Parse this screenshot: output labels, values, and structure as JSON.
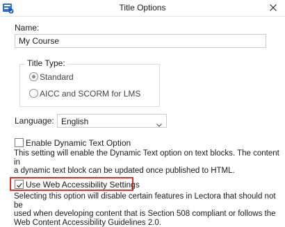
{
  "window": {
    "title": "Title Options"
  },
  "icons": {
    "app": "lectora-app-icon",
    "close": "close-icon",
    "check": "checkmark-icon",
    "dropdown": "chevron-down-icon"
  },
  "colors": {
    "highlight": "#d9342b",
    "app_icon": "#2f6fd1"
  },
  "form": {
    "name_label": "Name:",
    "name_value": "My Course",
    "title_type": {
      "label": "Title Type:",
      "options": [
        "Standard",
        "AICC and SCORM for LMS"
      ],
      "selected": "Standard"
    },
    "language": {
      "label": "Language:",
      "value": "English"
    },
    "dynamic_text": {
      "label": "Enable Dynamic Text Option",
      "checked": false,
      "description_line1": "This setting will enable the Dynamic Text option on text blocks. The content in",
      "description_line2": "a dynamic text block can be updated once published to HTML."
    },
    "web_accessibility": {
      "label": "Use Web Accessibility Settings",
      "checked": true,
      "description_line1": "Selecting this option will disable certain features in Lectora that should not be",
      "description_line2": "used when developing content that is Section 508 compliant or follows the",
      "description_line3": "Web Content Accessibility Guidelines 2.0."
    }
  }
}
